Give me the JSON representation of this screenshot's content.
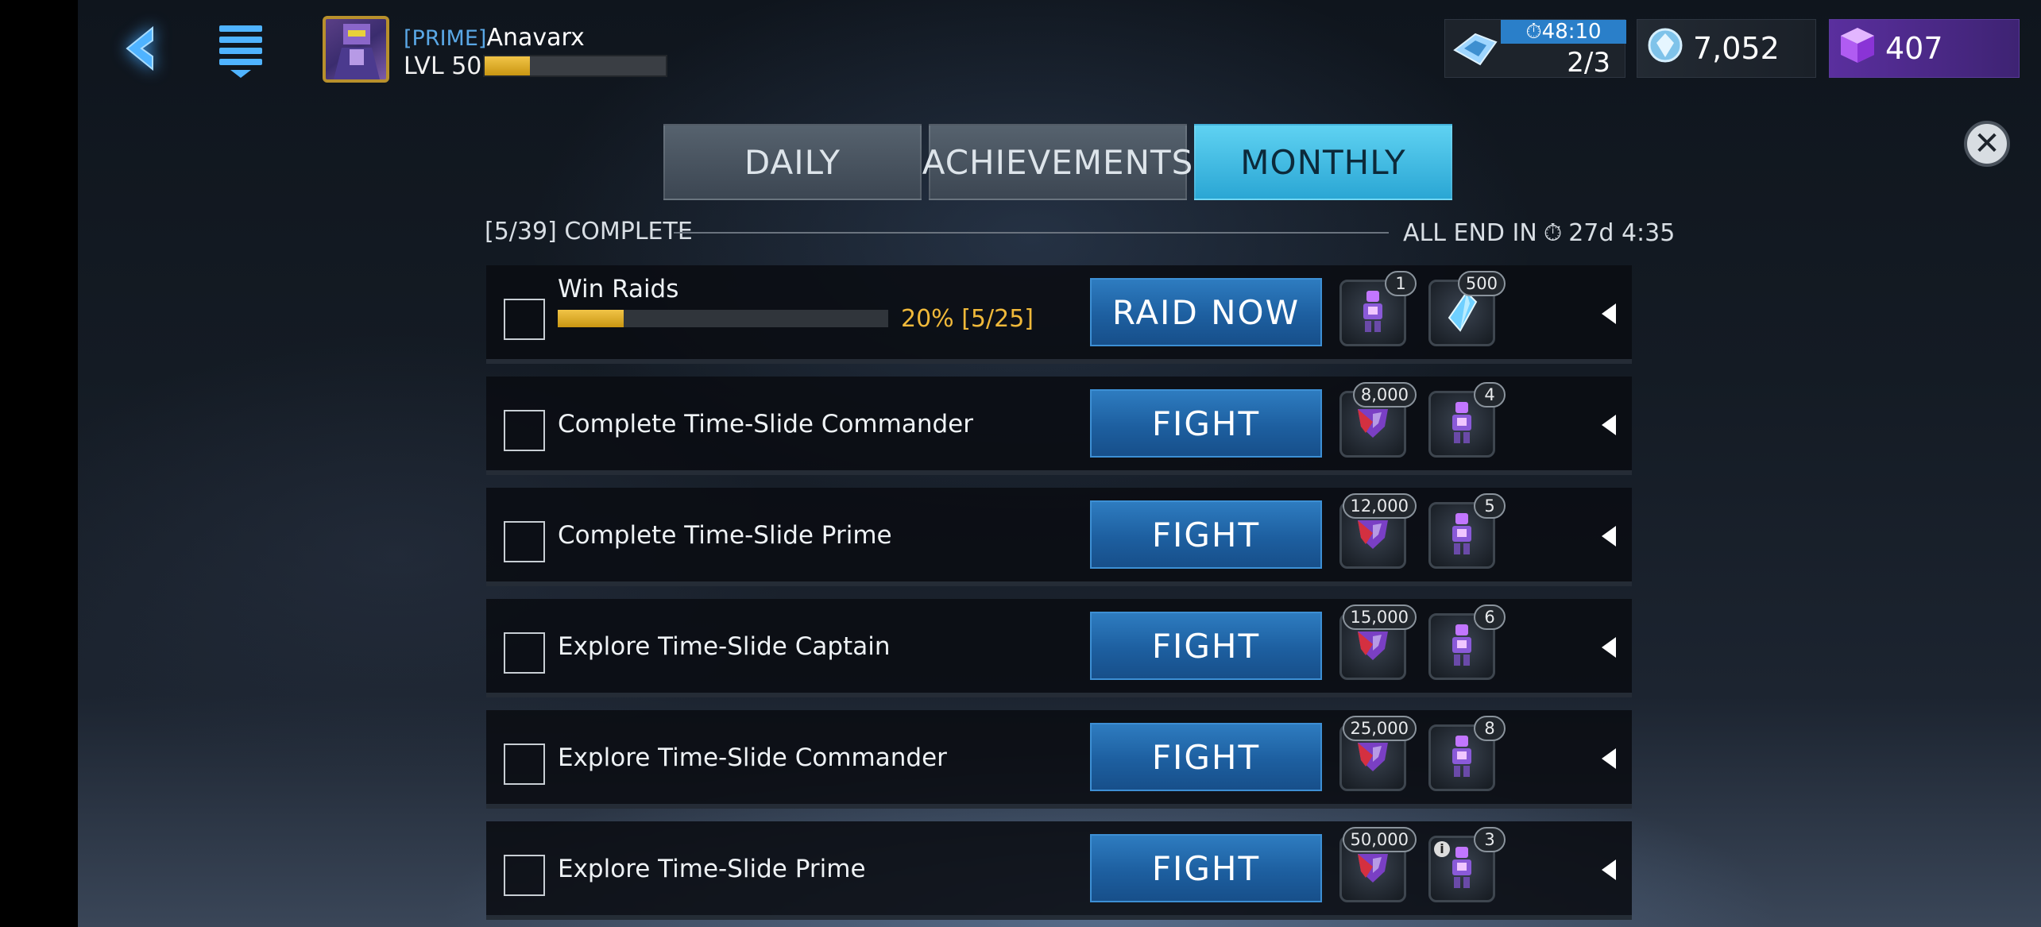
{
  "header": {
    "player_tag": "[PRIME]",
    "player_name": "Anavarx",
    "level_label": "LVL 50",
    "xp_fraction": 0.25,
    "energy_timer": "48:10",
    "energy_count": "2/3",
    "crystals": "7,052",
    "gems": "407"
  },
  "tabs": [
    {
      "label": "DAILY",
      "active": false
    },
    {
      "label": "ACHIEVEMENTS",
      "active": false
    },
    {
      "label": "MONTHLY",
      "active": true
    }
  ],
  "progress": {
    "complete_label": "[5/39] COMPLETE",
    "end_label": "ALL END IN",
    "end_time": "27d 4:35"
  },
  "missions": [
    {
      "title": "Win Raids",
      "progress_text": "20%  [5/25]",
      "progress_fraction": 0.2,
      "action": "RAID NOW",
      "rewards": [
        {
          "icon": "bot-icon",
          "count": "1"
        },
        {
          "icon": "crystal-icon",
          "count": "500"
        }
      ]
    },
    {
      "title": "Complete Time-Slide Commander",
      "action": "FIGHT",
      "rewards": [
        {
          "icon": "decepticon-icon",
          "count": "8,000"
        },
        {
          "icon": "bot-icon",
          "count": "4"
        }
      ]
    },
    {
      "title": "Complete Time-Slide Prime",
      "action": "FIGHT",
      "rewards": [
        {
          "icon": "decepticon-icon",
          "count": "12,000"
        },
        {
          "icon": "bot-icon",
          "count": "5"
        }
      ]
    },
    {
      "title": "Explore Time-Slide Captain",
      "action": "FIGHT",
      "rewards": [
        {
          "icon": "decepticon-icon",
          "count": "15,000"
        },
        {
          "icon": "bot-icon",
          "count": "6"
        }
      ]
    },
    {
      "title": "Explore Time-Slide Commander",
      "action": "FIGHT",
      "rewards": [
        {
          "icon": "decepticon-icon",
          "count": "25,000"
        },
        {
          "icon": "bot-icon",
          "count": "8"
        }
      ]
    },
    {
      "title": "Explore Time-Slide Prime",
      "action": "FIGHT",
      "rewards": [
        {
          "icon": "decepticon-icon",
          "count": "50,000"
        },
        {
          "icon": "bot-icon",
          "count": "3"
        }
      ]
    }
  ],
  "colors": {
    "accent_blue": "#2aa6d4",
    "button_blue": "#1d5fa0",
    "progress_gold": "#f0b93a",
    "gem_purple": "#5a2f9e"
  }
}
